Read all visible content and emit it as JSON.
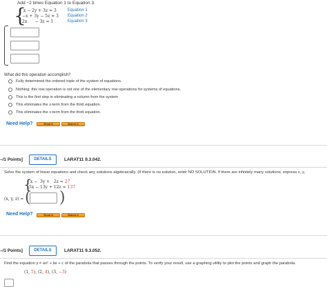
{
  "q1": {
    "instruction": "Add −2 times Equation 1 to Equation 3.",
    "system": [
      {
        "eq": " x − 2y + 3z = 3",
        "label": "Equation 1"
      },
      {
        "eq": "−x + 3y − 5z = 3",
        "label": "Equation 2"
      },
      {
        "eq": "2x      − 3z = 1",
        "label": "Equation 3"
      }
    ],
    "question": "What did this operation accomplish?",
    "options": [
      "Fully determined the ordered triple of the system of equations.",
      "Nothing; this row operation is not one of the elementary row operations for systems of equations.",
      "This is the first step in eliminating a column from the system",
      "This eliminates the z-term from the third equation.",
      "This eliminates the x-term from the third equation."
    ],
    "need_help": "Need Help?",
    "read_it": "Read It",
    "watch_it": "Watch It"
  },
  "q2": {
    "points": "–/1 Points]",
    "details": "DETAILS",
    "code": "LARAT11 9.3.042.",
    "text": "Solve the system of linear equations and check any solutions algebraically. (If there is no solution, enter NO SOLUTION. If there are infinitely many solutions, express x, y,",
    "eq1": {
      "lhs": " x −  3y +   2z = ",
      "rhs": "27"
    },
    "eq2": {
      "lhs": "5x − 13y + 12z = ",
      "rhs": "137"
    },
    "xyz_label": "(x, y, z) =",
    "need_help": "Need Help?",
    "read_it": "Read It",
    "watch_it": "Watch It"
  },
  "q3": {
    "points": "–/1 Points]",
    "details": "DETAILS",
    "code": "LARAT11 9.3.052.",
    "text": "Find the equation y = ax² + bx + c of the parabola that passes through the points. To verify your result, use a graphing utility to plot the points and graph the parabola.",
    "points_list": [
      {
        "pre": "(1, ",
        "val": "5",
        "post": "), "
      },
      {
        "pre": "(2, ",
        "val": "4",
        "post": "), "
      },
      {
        "pre": "(3, ",
        "val": "−3",
        "post": ")"
      }
    ]
  },
  "colors": {
    "accent": "#1b6fc0",
    "red": "#d63b3b",
    "button": "#e69018"
  }
}
